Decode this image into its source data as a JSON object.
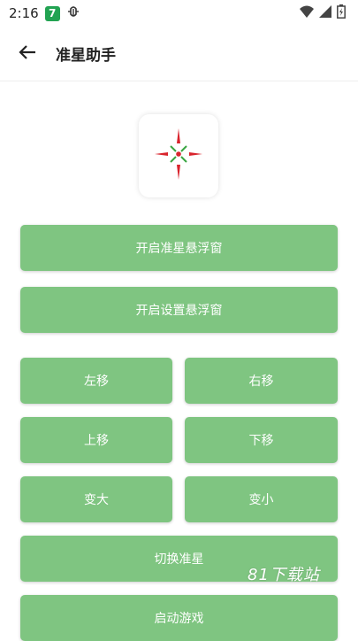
{
  "status_bar": {
    "time": "2:16",
    "notification_badge": "7",
    "notification_icon": "bug-icon",
    "icons": [
      "wifi-icon",
      "signal-icon",
      "battery-charging-icon"
    ]
  },
  "app_bar": {
    "back_icon": "arrow-left-icon",
    "title": "准星助手"
  },
  "logo": {
    "icon": "crosshair-icon",
    "colors": {
      "red": "#d9242d",
      "green": "#3aa542"
    }
  },
  "buttons": {
    "open_crosshair_overlay": "开启准星悬浮窗",
    "open_settings_overlay": "开启设置悬浮窗",
    "move_left": "左移",
    "move_right": "右移",
    "move_up": "上移",
    "move_down": "下移",
    "enlarge": "变大",
    "shrink": "变小",
    "switch_crosshair": "切换准星",
    "launch_game": "启动游戏"
  },
  "watermark": "81下载站",
  "colors": {
    "button_bg": "#7fc581",
    "button_text": "#ffffff"
  }
}
